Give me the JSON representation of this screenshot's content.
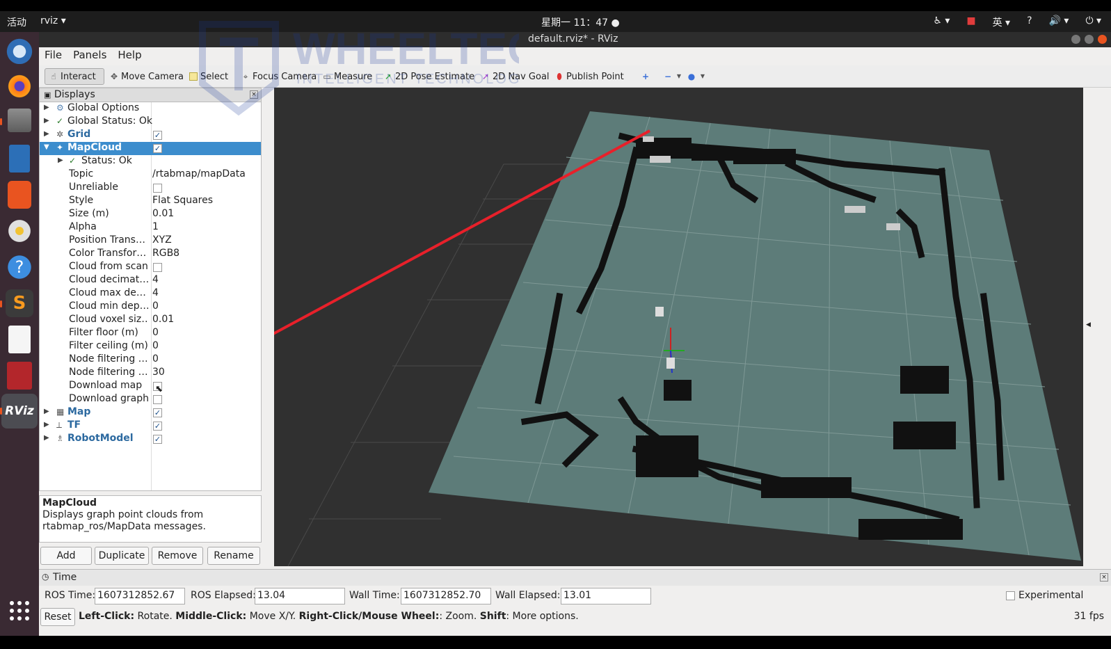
{
  "topbar": {
    "activities": "活动",
    "app_menu": "rviz ▾",
    "clock": "星期一 11：47 ●",
    "tray": [
      "♿ ▾",
      "■",
      "英 ▾",
      "?",
      "🔊 ▾",
      "⏻ ▾"
    ]
  },
  "window": {
    "title": "default.rviz* - RViz"
  },
  "menu": [
    "File",
    "Panels",
    "Help"
  ],
  "toolbar": {
    "interact": "Interact",
    "move_camera": "Move Camera",
    "select": "Select",
    "focus_camera": "Focus Camera",
    "measure": "Measure",
    "pose_estimate": "2D Pose Estimate",
    "nav_goal": "2D Nav Goal",
    "publish_point": "Publish Point"
  },
  "displays_panel": {
    "title": "Displays",
    "global_options": "Global Options",
    "global_status": "Global Status: Ok",
    "grid": "Grid",
    "mapcloud": "MapCloud",
    "status_ok": "Status: Ok",
    "props": [
      {
        "name": "Topic",
        "value": "/rtabmap/mapData"
      },
      {
        "name": "Unreliable",
        "value": ""
      },
      {
        "name": "Style",
        "value": "Flat Squares"
      },
      {
        "name": "Size (m)",
        "value": "0.01"
      },
      {
        "name": "Alpha",
        "value": "1"
      },
      {
        "name": "Position Trans…",
        "value": "XYZ"
      },
      {
        "name": "Color Transfor…",
        "value": "RGB8"
      },
      {
        "name": "Cloud from scan",
        "value": ""
      },
      {
        "name": "Cloud decimat…",
        "value": "4"
      },
      {
        "name": "Cloud max de…",
        "value": "4"
      },
      {
        "name": "Cloud min dep…",
        "value": "0"
      },
      {
        "name": "Cloud voxel siz…",
        "value": "0.01"
      },
      {
        "name": "Filter floor (m)",
        "value": "0"
      },
      {
        "name": "Filter ceiling (m)",
        "value": "0"
      },
      {
        "name": "Node filtering …",
        "value": "0"
      },
      {
        "name": "Node filtering …",
        "value": "30"
      },
      {
        "name": "Download map",
        "value": ""
      },
      {
        "name": "Download graph",
        "value": ""
      }
    ],
    "map": "Map",
    "tf": "TF",
    "robotmodel": "RobotModel"
  },
  "description": {
    "title": "MapCloud",
    "text": "Displays graph point clouds from rtabmap_ros/MapData messages."
  },
  "buttons": {
    "add": "Add",
    "duplicate": "Duplicate",
    "remove": "Remove",
    "rename": "Rename"
  },
  "time_panel": {
    "title": "Time",
    "ros_time_label": "ROS Time:",
    "ros_time": "1607312852.67",
    "ros_elapsed_label": "ROS Elapsed:",
    "ros_elapsed": "13.04",
    "wall_time_label": "Wall Time:",
    "wall_time": "1607312852.70",
    "wall_elapsed_label": "Wall Elapsed:",
    "wall_elapsed": "13.01",
    "experimental": "Experimental"
  },
  "status": {
    "reset": "Reset",
    "left_click": "Left-Click:",
    "left_click_desc": " Rotate. ",
    "middle_click": "Middle-Click:",
    "middle_click_desc": " Move X/Y. ",
    "right_click": "Right-Click/Mouse Wheel:",
    "right_click_desc": ": Zoom. ",
    "shift": "Shift",
    "shift_desc": ": More options.",
    "fps": "31 fps"
  },
  "watermark": {
    "brand": "WHEELTEC",
    "tagline": "INTELLIGENT TECHNOLOGY"
  },
  "colors": {
    "selection": "#3c8dcd",
    "plane": "#5d7c79",
    "annotation_arrow": "#e8202a",
    "accent": "#e95420"
  }
}
